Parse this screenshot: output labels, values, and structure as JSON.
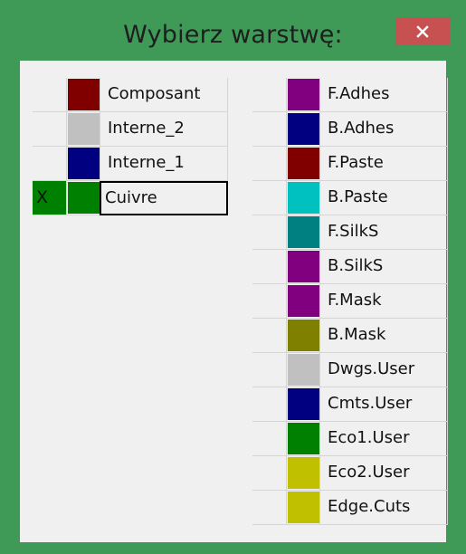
{
  "window": {
    "title": "Wybierz warstwę:",
    "close_glyph": "×",
    "frame_color": "#3f9a58",
    "close_color": "#c75050"
  },
  "left_layers": [
    {
      "marker": "",
      "name": "Composant",
      "color": "#800000"
    },
    {
      "marker": "",
      "name": "Interne_2",
      "color": "#c0c0c0"
    },
    {
      "marker": "",
      "name": "Interne_1",
      "color": "#000080"
    },
    {
      "marker": "X",
      "name": "Cuivre",
      "color": "#008000",
      "current": true
    }
  ],
  "right_layers": [
    {
      "marker": "",
      "name": "F.Adhes",
      "color": "#800080"
    },
    {
      "marker": "",
      "name": "B.Adhes",
      "color": "#000080"
    },
    {
      "marker": "",
      "name": "F.Paste",
      "color": "#800000"
    },
    {
      "marker": "",
      "name": "B.Paste",
      "color": "#00c0c0"
    },
    {
      "marker": "",
      "name": "F.SilkS",
      "color": "#008080"
    },
    {
      "marker": "",
      "name": "B.SilkS",
      "color": "#800080"
    },
    {
      "marker": "",
      "name": "F.Mask",
      "color": "#800080"
    },
    {
      "marker": "",
      "name": "B.Mask",
      "color": "#808000"
    },
    {
      "marker": "",
      "name": "Dwgs.User",
      "color": "#c0c0c0"
    },
    {
      "marker": "",
      "name": "Cmts.User",
      "color": "#000080"
    },
    {
      "marker": "",
      "name": "Eco1.User",
      "color": "#008000"
    },
    {
      "marker": "",
      "name": "Eco2.User",
      "color": "#c0c000"
    },
    {
      "marker": "",
      "name": "Edge.Cuts",
      "color": "#c0c000"
    }
  ]
}
